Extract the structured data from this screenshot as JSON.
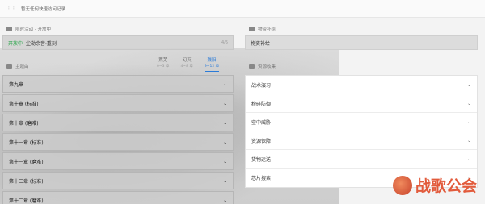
{
  "top_bar": {
    "message": "暂无任何快速访问记录"
  },
  "event_section": {
    "title": "限时活动 - 开放中"
  },
  "event": {
    "status": "开放中",
    "name": "尘勒余音·重刻",
    "count": "4/5"
  },
  "supply_section": {
    "title": "物资补给"
  },
  "supply": {
    "label": "物资补给"
  },
  "story_section": {
    "title": "主题曲"
  },
  "tabs": [
    {
      "label": "荒芜",
      "sub": "0~3 章"
    },
    {
      "label": "幻灭",
      "sub": "4~8 章"
    },
    {
      "label": "残阳",
      "sub": "9~12 章"
    }
  ],
  "story_items": [
    {
      "label": "第九章"
    },
    {
      "label": "第十章 (标准)"
    },
    {
      "label": "第十章 (磨难)"
    },
    {
      "label": "第十一章 (标准)"
    },
    {
      "label": "第十一章 (磨难)"
    },
    {
      "label": "第十二章 (标准)"
    },
    {
      "label": "第十二章 (磨难)"
    }
  ],
  "resource_section": {
    "title": "资源收集"
  },
  "resource_items": [
    {
      "label": "战术演习"
    },
    {
      "label": "粉碎防御"
    },
    {
      "label": "空中威胁"
    },
    {
      "label": "资源保障"
    },
    {
      "label": "货物运送"
    },
    {
      "label": "芯片搜索"
    }
  ],
  "watermark": {
    "text": "战歌公会"
  },
  "colors": {
    "accent": "#2b7bd8",
    "open_status": "#2aa64a",
    "watermark": "#e25b3c"
  }
}
